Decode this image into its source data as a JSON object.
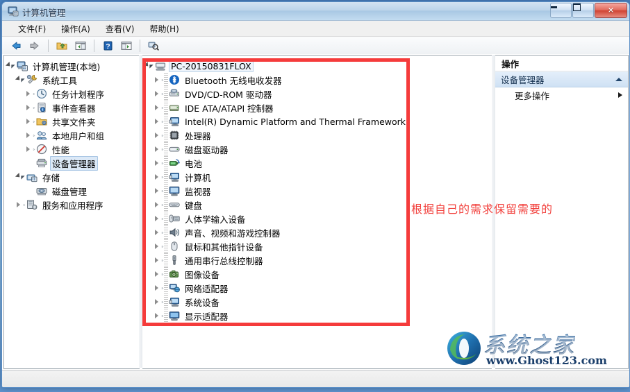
{
  "window": {
    "title": "计算机管理",
    "icon": "computer-management-icon",
    "controls": {
      "minimize": "最小化",
      "maximize": "最大化",
      "close": "关闭"
    }
  },
  "menubar": {
    "items": [
      {
        "label": "文件(F)",
        "name": "menu-file"
      },
      {
        "label": "操作(A)",
        "name": "menu-action"
      },
      {
        "label": "查看(V)",
        "name": "menu-view"
      },
      {
        "label": "帮助(H)",
        "name": "menu-help"
      }
    ]
  },
  "toolbar": {
    "buttons": [
      {
        "name": "back-icon",
        "title": "后退"
      },
      {
        "name": "forward-icon",
        "title": "前进"
      },
      {
        "name": "up-folder-icon",
        "title": "上移一级"
      },
      {
        "name": "show-tree-icon",
        "title": "显示/隐藏控制台树"
      },
      {
        "name": "help-icon",
        "title": "帮助"
      },
      {
        "name": "show-pane-icon",
        "title": "显示/隐藏操作窗格"
      },
      {
        "name": "scan-hardware-icon",
        "title": "扫描检测硬件改动"
      }
    ]
  },
  "sidebar": {
    "items": [
      {
        "label": "计算机管理(本地)",
        "indent": 0,
        "twist": "open",
        "icon": "computer-management-icon",
        "selected": false
      },
      {
        "label": "系统工具",
        "indent": 1,
        "twist": "open",
        "icon": "system-tools-icon",
        "selected": false
      },
      {
        "label": "任务计划程序",
        "indent": 2,
        "twist": "closed",
        "icon": "task-scheduler-icon",
        "selected": false
      },
      {
        "label": "事件查看器",
        "indent": 2,
        "twist": "closed",
        "icon": "event-viewer-icon",
        "selected": false
      },
      {
        "label": "共享文件夹",
        "indent": 2,
        "twist": "closed",
        "icon": "shared-folders-icon",
        "selected": false
      },
      {
        "label": "本地用户和组",
        "indent": 2,
        "twist": "closed",
        "icon": "local-users-groups-icon",
        "selected": false
      },
      {
        "label": "性能",
        "indent": 2,
        "twist": "closed",
        "icon": "performance-icon",
        "selected": false
      },
      {
        "label": "设备管理器",
        "indent": 2,
        "twist": "none",
        "icon": "device-manager-icon",
        "selected": true
      },
      {
        "label": "存储",
        "indent": 1,
        "twist": "open",
        "icon": "storage-icon",
        "selected": false
      },
      {
        "label": "磁盘管理",
        "indent": 2,
        "twist": "none",
        "icon": "disk-management-icon",
        "selected": false
      },
      {
        "label": "服务和应用程序",
        "indent": 1,
        "twist": "closed",
        "icon": "services-apps-icon",
        "selected": false
      }
    ]
  },
  "device_tree": {
    "root": {
      "label": "PC-20150831FLOX",
      "icon": "computer-icon",
      "twist": "open"
    },
    "items": [
      {
        "label": "Bluetooth 无线电收发器",
        "icon": "bluetooth-icon"
      },
      {
        "label": "DVD/CD-ROM 驱动器",
        "icon": "dvd-drive-icon"
      },
      {
        "label": "IDE ATA/ATAPI 控制器",
        "icon": "ide-controller-icon"
      },
      {
        "label": "Intel(R) Dynamic Platform and Thermal Framework",
        "icon": "system-device-icon"
      },
      {
        "label": "处理器",
        "icon": "processor-icon"
      },
      {
        "label": "磁盘驱动器",
        "icon": "disk-drive-icon"
      },
      {
        "label": "电池",
        "icon": "battery-icon"
      },
      {
        "label": "计算机",
        "icon": "computer-device-icon"
      },
      {
        "label": "监视器",
        "icon": "monitor-icon"
      },
      {
        "label": "键盘",
        "icon": "keyboard-icon"
      },
      {
        "label": "人体学输入设备",
        "icon": "hid-icon"
      },
      {
        "label": "声音、视频和游戏控制器",
        "icon": "sound-icon"
      },
      {
        "label": "鼠标和其他指针设备",
        "icon": "mouse-icon"
      },
      {
        "label": "通用串行总线控制器",
        "icon": "usb-icon"
      },
      {
        "label": "图像设备",
        "icon": "imaging-device-icon"
      },
      {
        "label": "网络适配器",
        "icon": "network-adapter-icon"
      },
      {
        "label": "系统设备",
        "icon": "system-device-icon"
      },
      {
        "label": "显示适配器",
        "icon": "display-adapter-icon"
      }
    ]
  },
  "actions_pane": {
    "header": "操作",
    "group": {
      "label": "设备管理器",
      "collapse_icon": "caret-up-icon"
    },
    "items": [
      {
        "label": "更多操作",
        "submenu_icon": "caret-right-icon"
      }
    ]
  },
  "annotation": {
    "text": "根据自己的需求保留需要的",
    "color": "#f2433f",
    "box_color": "#f53b3b"
  },
  "watermark": {
    "brand": "系统之家",
    "url": "www.Ghost123.com",
    "logo": "ghost123-logo-icon"
  }
}
